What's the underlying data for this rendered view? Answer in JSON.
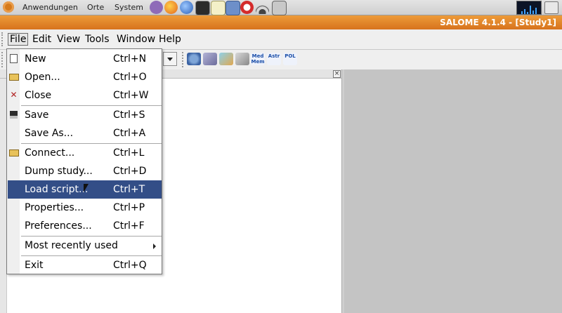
{
  "gnome_panel": {
    "menus": [
      "Anwendungen",
      "Orte",
      "System"
    ],
    "launchers": [
      "help-icon",
      "firefox-icon",
      "globe-icon",
      "terminal-icon",
      "notes-icon",
      "editor-icon",
      "opera-icon",
      "network-icon",
      "package-icon"
    ]
  },
  "window": {
    "title": "SALOME 4.1.4 - [Study1]"
  },
  "menubar": {
    "items": [
      {
        "label": "File",
        "mnemonic": "F"
      },
      {
        "label": "Edit",
        "mnemonic": "E"
      },
      {
        "label": "View",
        "mnemonic": "V"
      },
      {
        "label": "Tools",
        "mnemonic": "T"
      },
      {
        "label": "Window",
        "mnemonic": "W"
      },
      {
        "label": "Help",
        "mnemonic": "H"
      }
    ]
  },
  "toolbar": {
    "buttons": [
      {
        "name": "geometry-module-button",
        "text": ""
      },
      {
        "name": "mesh-module-button",
        "text": ""
      },
      {
        "name": "post-pro-module-button",
        "text": ""
      },
      {
        "name": "supervisor-module-button",
        "text": ""
      },
      {
        "name": "med-module-button",
        "text": "Med Mem"
      },
      {
        "name": "aster-module-button",
        "text": "Astr"
      },
      {
        "name": "pol-module-button",
        "text": "POL"
      }
    ]
  },
  "dock": {
    "close_label": "×"
  },
  "file_menu": {
    "items": [
      {
        "label": "New",
        "shortcut": "Ctrl+N",
        "icon": "new-document-icon"
      },
      {
        "label": "Open...",
        "shortcut": "Ctrl+O",
        "icon": "open-folder-icon"
      },
      {
        "label": "Close",
        "shortcut": "Ctrl+W",
        "icon": "close-x-icon"
      },
      {
        "label": "Save",
        "shortcut": "Ctrl+S",
        "icon": "save-disk-icon"
      },
      {
        "label": "Save As...",
        "shortcut": "Ctrl+A",
        "icon": ""
      },
      {
        "label": "Connect...",
        "shortcut": "Ctrl+L",
        "icon": "connect-folder-icon"
      },
      {
        "label": "Dump study...",
        "shortcut": "Ctrl+D",
        "icon": ""
      },
      {
        "label": "Load script...",
        "shortcut": "Ctrl+T",
        "icon": "",
        "highlighted": true
      },
      {
        "label": "Properties...",
        "shortcut": "Ctrl+P",
        "icon": ""
      },
      {
        "label": "Preferences...",
        "shortcut": "Ctrl+F",
        "icon": ""
      },
      {
        "label": "Most recently used",
        "shortcut": "",
        "icon": "",
        "submenu": true
      },
      {
        "label": "Exit",
        "shortcut": "Ctrl+Q",
        "icon": ""
      }
    ]
  }
}
